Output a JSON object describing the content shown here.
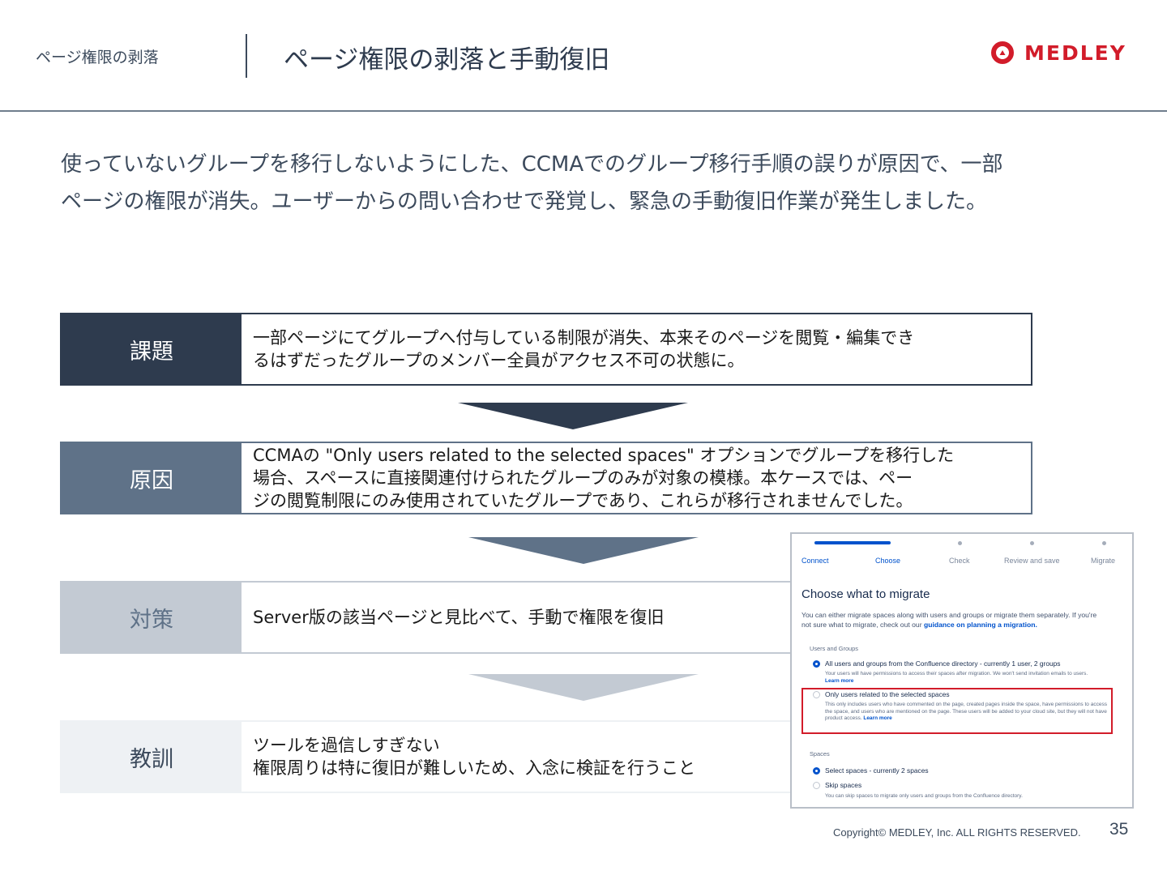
{
  "header": {
    "section_label": "ページ権限の剥落",
    "title": "ページ権限の剥落と手動復旧",
    "logo_text": "MEDLEY"
  },
  "lead": {
    "line1": "使っていないグループを移行しないようにした、CCMAでのグループ移行手順の誤りが原因で、一部",
    "line2": "ページの権限が消失。ユーザーからの問い合わせで発覚し、緊急の手動復旧作業が発生しました。"
  },
  "rows": [
    {
      "label": "課題",
      "lines": [
        "一部ページにてグループへ付与している制限が消失、本来そのページを閲覧・編集でき",
        "るはずだったグループのメンバー全員がアクセス不可の状態に。"
      ]
    },
    {
      "label": "原因",
      "lines": [
        "CCMAの \"Only users related to the selected spaces\" オプションでグループを移行した",
        "場合、スペースに直接関連付けられたグループのみが対象の模様。本ケースでは、ペー",
        "ジの閲覧制限にのみ使用されていたグループであり、これらが移行されませんでした。"
      ]
    },
    {
      "label": "対策",
      "lines": [
        "Server版の該当ページと見比べて、手動で権限を復旧"
      ]
    },
    {
      "label": "教訓",
      "lines": [
        "ツールを過信しすぎない",
        "権限周りは特に復旧が難しいため、入念に検証を行うこと"
      ]
    }
  ],
  "screenshot": {
    "steps": [
      "Connect",
      "Choose",
      "Check",
      "Review and save",
      "Migrate"
    ],
    "title": "Choose what to migrate",
    "desc_line1": "You can either migrate spaces along with users and groups or migrate them separately. If you're",
    "desc_line2_prefix": "not sure what to migrate, check out our ",
    "desc_link": "guidance on planning a migration.",
    "users_heading": "Users and Groups",
    "opt_all_title": "All users and groups from the Confluence directory - currently 1 user, 2 groups",
    "opt_all_desc": "Your users will have permissions to access their spaces after migration. We won't send invitation emails to users.",
    "learn_more": "Learn more",
    "opt_related_title": "Only users related to the selected spaces",
    "opt_related_desc": "This only includes users who have commented on the page, created pages inside the space, have permissions to access the space, and users who are mentioned on the page. These users will be added to your cloud site, but they will not have product access.",
    "spaces_heading": "Spaces",
    "opt_select_title": "Select spaces - currently 2 spaces",
    "opt_skip_title": "Skip spaces",
    "opt_skip_desc": "You can skip spaces to migrate only users and groups from the Confluence directory."
  },
  "footer": {
    "copyright": "Copyright© MEDLEY, Inc. ALL RIGHTS RESERVED.",
    "page_number": "35"
  },
  "colors": {
    "navy": "#2e3b4e",
    "slate": "#5f7288",
    "light_slate": "#c3cad3",
    "pale": "#eef1f4",
    "brand_red": "#d21c2a",
    "atlassian_blue": "#0052cc"
  }
}
